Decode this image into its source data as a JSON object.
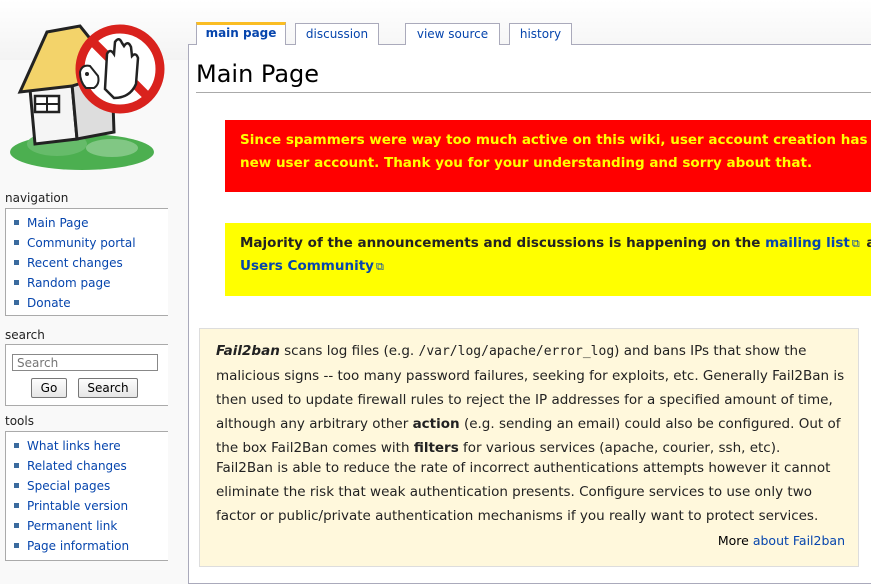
{
  "tabs": [
    "main page",
    "discussion",
    "view source",
    "history"
  ],
  "page_title": "Main Page",
  "navigation": {
    "title": "navigation",
    "items": [
      "Main Page",
      "Community portal",
      "Recent changes",
      "Random page",
      "Donate"
    ]
  },
  "search": {
    "title": "search",
    "placeholder": "Search",
    "go_label": "Go",
    "search_label": "Search"
  },
  "tools": {
    "title": "tools",
    "items": [
      "What links here",
      "Related changes",
      "Special pages",
      "Printable version",
      "Permanent link",
      "Page information"
    ]
  },
  "notice_red": {
    "line1": "Since spammers were way too much active on this wiki, user account creation has been",
    "line2": "new user account. Thank you for your understanding and sorry about that."
  },
  "notice_yellow": {
    "line1_prefix": "Majority of the announcements and discussions is happening on the ",
    "line1_link": "mailing list",
    "line1_suffix": " and G",
    "line2_link": "Users Community"
  },
  "intro": {
    "p1": {
      "s1": "Fail2ban",
      "s2": " scans log files (e.g. ",
      "s3": "/var/log/apache/error_log",
      "s4": ") and bans IPs that show the",
      "line2": "malicious signs -- too many password failures, seeking for exploits, etc. Generally Fail2Ban is",
      "line3": "then used to update firewall rules to reject the IP addresses for a specified amount of time,",
      "l4a": "although any arbitrary other ",
      "l4b": "action",
      "l4c": " (e.g. sending an email) could also be configured. Out of",
      "l5a": "the box Fail2Ban comes with ",
      "l5b": "filters",
      "l5c": " for various services (apache, courier, ssh, etc)."
    },
    "p2": {
      "line1": "Fail2Ban is able to reduce the rate of incorrect authentications attempts however it cannot",
      "line2": "eliminate the risk that weak authentication presents. Configure services to use only two",
      "line3": "factor or public/private authentication mechanisms if you really want to protect services."
    },
    "more_prefix": "More ",
    "more_link": "about Fail2ban"
  },
  "colors": {
    "link": "#0645ad",
    "notice_red_bg": "#ff0000",
    "notice_red_text": "#ffff00",
    "notice_yellow_bg": "#ffff00",
    "infobox_bg": "#fff8dc",
    "tab_selected_accent": "#fabd23"
  },
  "icons": {
    "logo": "house-no-entry-logo",
    "external": "external-link-icon",
    "bullet": "square-bullet"
  }
}
